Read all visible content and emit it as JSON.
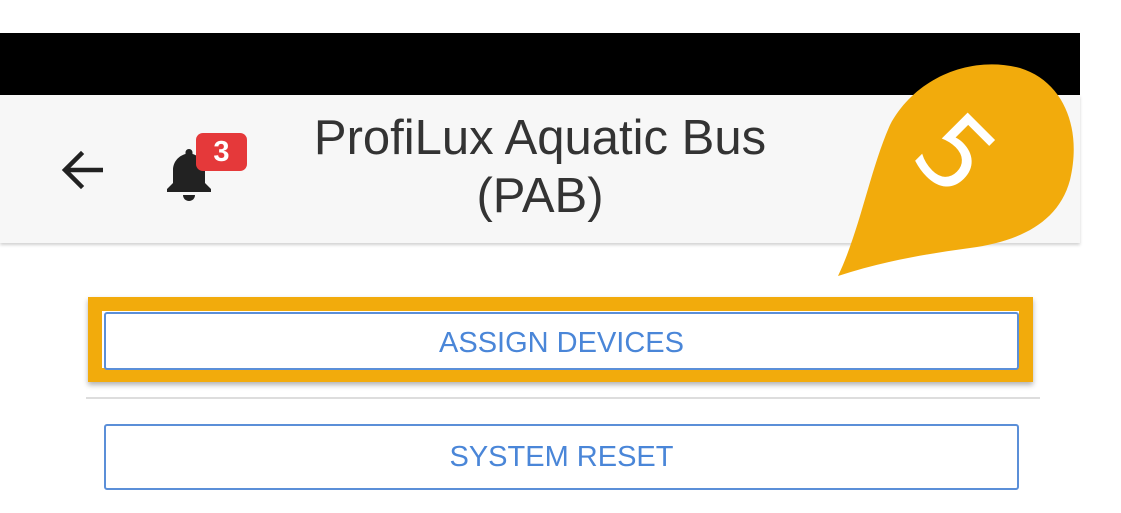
{
  "header": {
    "title_line1": "ProfiLux Aquatic Bus",
    "title_line2": "(PAB)",
    "back_icon": "arrow-left-icon",
    "bell_icon": "bell-icon",
    "notification_count": "3"
  },
  "callout": {
    "step_number": "5",
    "color": "#f2ab0c"
  },
  "actions": {
    "assign_devices_label": "ASSIGN DEVICES",
    "system_reset_label": "SYSTEM RESET"
  },
  "colors": {
    "accent": "#4a86d8",
    "badge": "#e5393a",
    "highlight": "#f2ab0c"
  }
}
